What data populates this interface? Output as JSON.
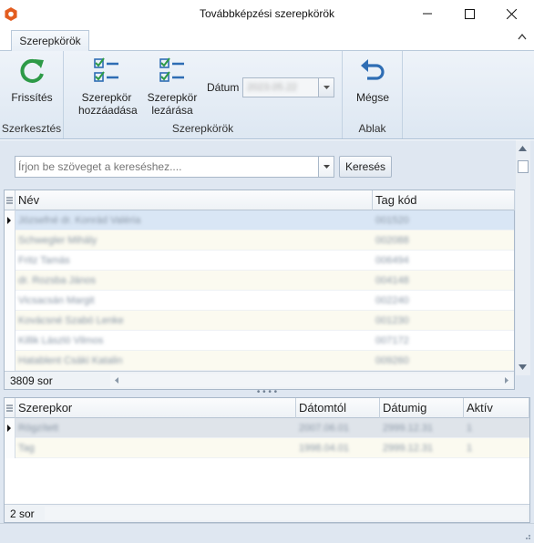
{
  "window": {
    "title": "Továbbképzési szerepkörök"
  },
  "ribbon": {
    "tab": "Szerepkörök",
    "groups": {
      "edit": {
        "label": "Szerkesztés",
        "refresh_label": "Frissítés"
      },
      "roles": {
        "label": "Szerepkörök",
        "add_line1": "Szerepkör",
        "add_line2": "hozzáadása",
        "close_line1": "Szerepkör",
        "close_line2": "lezárása",
        "date_label": "Dátum",
        "date_value": "2023.05.22"
      },
      "window": {
        "label": "Ablak",
        "cancel_label": "Mégse"
      }
    }
  },
  "search": {
    "placeholder": "Írjon be szöveget a kereséshez....",
    "button_label": "Keresés"
  },
  "people_grid": {
    "columns": [
      "Név",
      "Tag kód"
    ],
    "rows": [
      [
        "Józsefné dr. Konrád Valéria",
        "001520"
      ],
      [
        "Schwegler Mihály",
        "002088"
      ],
      [
        "Fritz Tamás",
        "006494"
      ],
      [
        "dr. Rozsba János",
        "004148"
      ],
      [
        "Vicsacsán Margit",
        "002240"
      ],
      [
        "Kovácsné Szabó Lenke",
        "001230"
      ],
      [
        "Killik László Vilmos",
        "007172"
      ],
      [
        "Hatablent Csáki Katalin",
        "009260"
      ]
    ],
    "count_label": "3809 sor"
  },
  "roles_grid": {
    "columns": [
      "Szerepkor",
      "Dátomtól",
      "Dátumig",
      "Aktív"
    ],
    "rows": [
      [
        "Rögzített",
        "2007.06.01",
        "2999.12.31",
        "1"
      ],
      [
        "Tag",
        "1998.04.01",
        "2999.12.31",
        "1"
      ]
    ],
    "count_label": "2 sor"
  },
  "colors": {
    "accent_green": "#2d9a47",
    "accent_blue": "#2e6db4",
    "app_icon": "#e35d1f"
  }
}
